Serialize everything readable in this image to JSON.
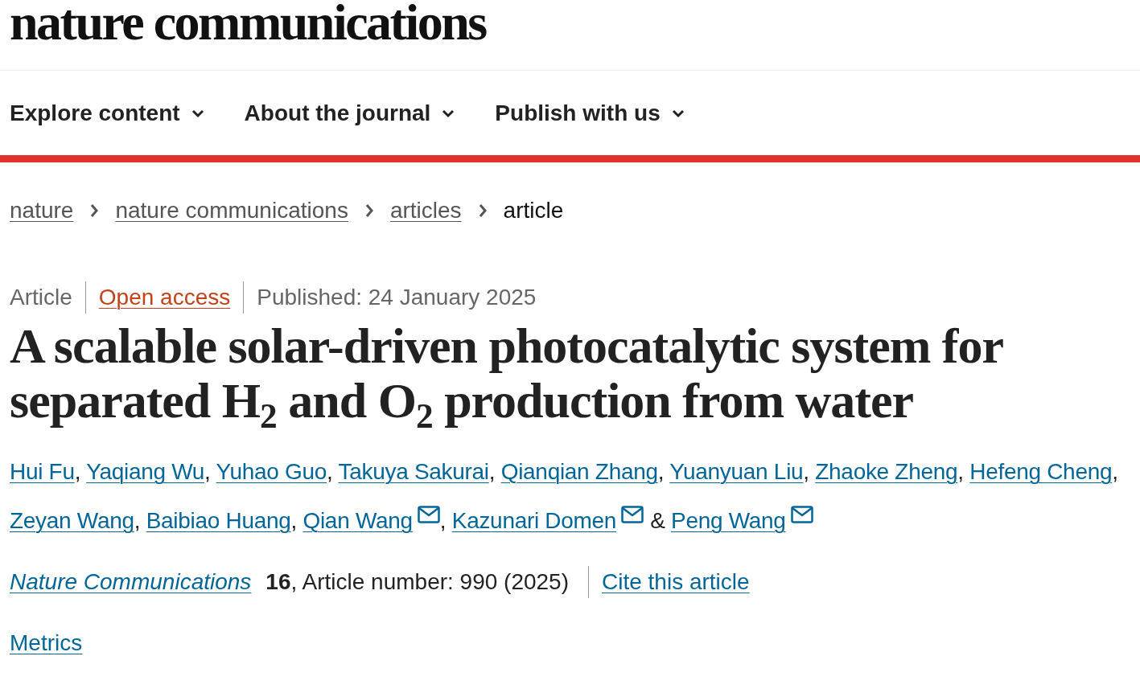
{
  "logo": "nature communications",
  "nav": [
    {
      "label": "Explore content",
      "expanded": false
    },
    {
      "label": "About the journal",
      "expanded": false
    },
    {
      "label": "Publish with us",
      "expanded": false
    }
  ],
  "breadcrumbs": [
    {
      "label": "nature",
      "link": true
    },
    {
      "label": "nature communications",
      "link": true
    },
    {
      "label": "articles",
      "link": true
    },
    {
      "label": "article",
      "link": false
    }
  ],
  "meta": {
    "type": "Article",
    "access": "Open access",
    "published": "Published: 24 January 2025"
  },
  "title": "A scalable solar-driven photocatalytic system for separated H$_{2}$ and O$_{2}$ production from water",
  "authors": [
    {
      "name": "Hui Fu",
      "corresponding": false
    },
    {
      "name": "Yaqiang Wu",
      "corresponding": false
    },
    {
      "name": "Yuhao Guo",
      "corresponding": false
    },
    {
      "name": "Takuya Sakurai",
      "corresponding": false
    },
    {
      "name": "Qianqian Zhang",
      "corresponding": false
    },
    {
      "name": "Yuanyuan Liu",
      "corresponding": false
    },
    {
      "name": "Zhaoke Zheng",
      "corresponding": false
    },
    {
      "name": "Hefeng Cheng",
      "corresponding": false
    },
    {
      "name": "Zeyan Wang",
      "corresponding": false
    },
    {
      "name": "Baibiao Huang",
      "corresponding": false
    },
    {
      "name": "Qian Wang",
      "corresponding": true
    },
    {
      "name": "Kazunari Domen",
      "corresponding": true
    },
    {
      "name": "Peng Wang",
      "corresponding": true
    }
  ],
  "author_separators": [
    ",",
    ",",
    ",",
    ",",
    ",",
    ",",
    ",",
    ",",
    ",",
    ",",
    ",",
    "&"
  ],
  "citation": {
    "journal": "Nature Communications",
    "details": "**16**, Article number: 990 (2025)",
    "cite_link": "Cite this article"
  },
  "metrics_link": "Metrics"
}
